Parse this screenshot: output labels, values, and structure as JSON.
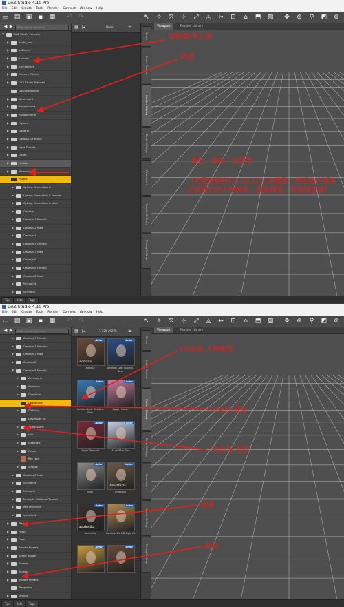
{
  "window_title": "DAZ Studio 4.10 Pro",
  "menu": [
    "File",
    "Edit",
    "Create",
    "Tools",
    "Render",
    "Connect",
    "Window",
    "Help"
  ],
  "search_placeholder": "Enter text to search by...",
  "top": {
    "filter_label": "None",
    "tree": [
      {
        "label": "DAZ Studio Formats",
        "indent": 0,
        "arrow": "▼"
      },
      {
        "label": "0ecfd_nes",
        "indent": 1,
        "arrow": "▶"
      },
      {
        "label": "anBlocks",
        "indent": 1,
        "arrow": "▶"
      },
      {
        "label": "Animals",
        "indent": 1,
        "arrow": "▶"
      },
      {
        "label": "Architecture",
        "indent": 1,
        "arrow": "▶"
      },
      {
        "label": "Camera Presets",
        "indent": 1,
        "arrow": "▶"
      },
      {
        "label": "DAZ Studio Tutorials",
        "indent": 1,
        "arrow": "▶"
      },
      {
        "label": "Documentation",
        "indent": 1,
        "arrow": ""
      },
      {
        "label": "Dreamlight",
        "indent": 1,
        "arrow": "▶"
      },
      {
        "label": "Environment",
        "indent": 1,
        "arrow": "▶"
      },
      {
        "label": "Environments",
        "indent": 1,
        "arrow": "▶"
      },
      {
        "label": "Figures",
        "indent": 1,
        "arrow": "▶"
      },
      {
        "label": "General",
        "indent": 1,
        "arrow": "▶"
      },
      {
        "label": "Genesis 8 Female",
        "indent": 1,
        "arrow": "▶"
      },
      {
        "label": "Light Presets",
        "indent": 1,
        "arrow": "▶"
      },
      {
        "label": "Lights",
        "indent": 1,
        "arrow": "▶"
      },
      {
        "label": "Lindsay",
        "indent": 1,
        "arrow": "▶",
        "state": "alt"
      },
      {
        "label": "Materials",
        "indent": 1,
        "arrow": "▶"
      },
      {
        "label": "People",
        "indent": 1,
        "arrow": "▼",
        "state": "sel"
      },
      {
        "label": "Cyborg Generation 8",
        "indent": 2,
        "arrow": "▶"
      },
      {
        "label": "Cyborg Generation 8 Female",
        "indent": 2,
        "arrow": "▶"
      },
      {
        "label": "Cyborg Generation 8 Male",
        "indent": 2,
        "arrow": "▶"
      },
      {
        "label": "Genesis",
        "indent": 2,
        "arrow": "▶"
      },
      {
        "label": "Genesis 2 Female",
        "indent": 2,
        "arrow": "▶"
      },
      {
        "label": "Genesis 2 Male",
        "indent": 2,
        "arrow": "▶"
      },
      {
        "label": "Genesis 3",
        "indent": 2,
        "arrow": "▶"
      },
      {
        "label": "Genesis 3 Female",
        "indent": 2,
        "arrow": "▶"
      },
      {
        "label": "Genesis 3 Male",
        "indent": 2,
        "arrow": "▶"
      },
      {
        "label": "Genesis 8",
        "indent": 2,
        "arrow": "▶"
      },
      {
        "label": "Genesis 8 Female",
        "indent": 2,
        "arrow": "▶"
      },
      {
        "label": "Genesis 8 Male",
        "indent": 2,
        "arrow": "▶"
      },
      {
        "label": "Michael 4",
        "indent": 2,
        "arrow": "▶"
      },
      {
        "label": "Michael4",
        "indent": 2,
        "arrow": "▶"
      },
      {
        "label": "Midnight Skeleton Genesis ...",
        "indent": 2,
        "arrow": "▶"
      }
    ],
    "annotations": {
      "animals": "动物类/非人类",
      "scene": "场景",
      "people": "角色、服装、发型等",
      "note": "（这里会细分G1,G2,G3,G8模型，然后每个版本还会细分成人物模型，服装模型，发型模型等）"
    }
  },
  "bottom": {
    "pager": "1-225 of 225",
    "tree": [
      {
        "label": "Genesis 3 Female",
        "indent": 2,
        "arrow": "▶"
      },
      {
        "label": "Genesis 3 Females",
        "indent": 2,
        "arrow": "▶"
      },
      {
        "label": "Genesis 3 Male",
        "indent": 2,
        "arrow": "▶"
      },
      {
        "label": "Genesis 8",
        "indent": 2,
        "arrow": "▶"
      },
      {
        "label": "Genesis 8 Female",
        "indent": 2,
        "arrow": "▼"
      },
      {
        "label": "Accessories",
        "indent": 3,
        "arrow": "▶"
      },
      {
        "label": "Anatomy",
        "indent": 3,
        "arrow": "▶"
      },
      {
        "label": "Character",
        "indent": 3,
        "arrow": "▶"
      },
      {
        "label": "Characters",
        "indent": 3,
        "arrow": "▶",
        "state": "sel"
      },
      {
        "label": "Clothing",
        "indent": 3,
        "arrow": "▶"
      },
      {
        "label": "Developer Kit",
        "indent": 3,
        "arrow": ""
      },
      {
        "label": "Expressions",
        "indent": 3,
        "arrow": "▶"
      },
      {
        "label": "Hair",
        "indent": 3,
        "arrow": "▶"
      },
      {
        "label": "Materials",
        "indent": 3,
        "arrow": "▶"
      },
      {
        "label": "Poses",
        "indent": 3,
        "arrow": "▶"
      },
      {
        "label": "Rey Hair",
        "indent": 3,
        "arrow": "",
        "avatar": true
      },
      {
        "label": "Shapes",
        "indent": 3,
        "arrow": "▶"
      },
      {
        "label": "Genesis 8 Male",
        "indent": 2,
        "arrow": "▶"
      },
      {
        "label": "Michael 4",
        "indent": 2,
        "arrow": "▶"
      },
      {
        "label": "Michael4",
        "indent": 2,
        "arrow": "▶"
      },
      {
        "label": "Midnight Skeleton Genesis ...",
        "indent": 2,
        "arrow": "▶"
      },
      {
        "label": "Rex Mortifera",
        "indent": 2,
        "arrow": "▶"
      },
      {
        "label": "Victoria 4",
        "indent": 2,
        "arrow": "▶"
      },
      {
        "label": "Plants",
        "indent": 1,
        "arrow": "▶"
      },
      {
        "label": "Poses",
        "indent": 1,
        "arrow": "▶"
      },
      {
        "label": "Props",
        "indent": 1,
        "arrow": "▶"
      },
      {
        "label": "Render Presets",
        "indent": 1,
        "arrow": "▶"
      },
      {
        "label": "Scene Builder",
        "indent": 1,
        "arrow": "▶"
      },
      {
        "label": "Scenes",
        "indent": 1,
        "arrow": "▶"
      },
      {
        "label": "Scripts",
        "indent": 1,
        "arrow": "▶"
      },
      {
        "label": "Shader Presets",
        "indent": 1,
        "arrow": "▶"
      },
      {
        "label": "Templates",
        "indent": 1,
        "arrow": ""
      },
      {
        "label": "Vehicle",
        "indent": 1,
        "arrow": "▶"
      },
      {
        "label": "Vehicles",
        "indent": 1,
        "arrow": "▶"
      },
      {
        "label": "Poser Formats",
        "indent": 0,
        "arrow": "▶"
      }
    ],
    "thumbs": [
      {
        "caption": "Adriana",
        "overlay": "Adriana",
        "color": "#6b4a3a"
      },
      {
        "caption": "Aeridian Lady Stardust Base",
        "overlay": "",
        "color": "#2b4f8a"
      },
      {
        "caption": "Aeridian Lady Stardust Alien",
        "overlay": "",
        "color": "#3a7ab0"
      },
      {
        "caption": "Aguja Human",
        "overlay": "",
        "color": "#c87aa0"
      },
      {
        "caption": "Aguja Mermaid",
        "overlay": "",
        "color": "#7a2a3a"
      },
      {
        "caption": "Akari Alter-Ego",
        "overlay": "",
        "color": "#c8d0e8"
      },
      {
        "caption": "Akari",
        "overlay": "",
        "color": "#8a8a8a"
      },
      {
        "caption": "AnaMaria",
        "overlay": "Ana Maria",
        "color": "#6a5a4a"
      },
      {
        "caption": "Anzhelika",
        "overlay": "Anzhelika",
        "color": "#3a3030"
      },
      {
        "caption": "Aurelalia Kid HD Style 01",
        "overlay": "",
        "color": "#b08a50"
      },
      {
        "caption": "",
        "overlay": "",
        "color": "#c89a40"
      },
      {
        "caption": "",
        "overlay": "",
        "color": "#6a4a3a"
      }
    ],
    "annotations": {
      "g8_char": "G8女性  人物角色",
      "g8_cloth": "G8女性  服装",
      "g8_hair": "G8女性  发型",
      "props": "道具",
      "vehicle": "载具"
    }
  },
  "badge": "Actor",
  "viewport_tabs": [
    "Viewport",
    "Render Library"
  ],
  "side_tabs": [
    "Scene",
    "Smart Content",
    "Content Library",
    "Draw Settings",
    "Parameters",
    "Render Settings",
    "Posing Settings"
  ],
  "status_tabs": [
    "Tips",
    "Info",
    "Tags"
  ]
}
